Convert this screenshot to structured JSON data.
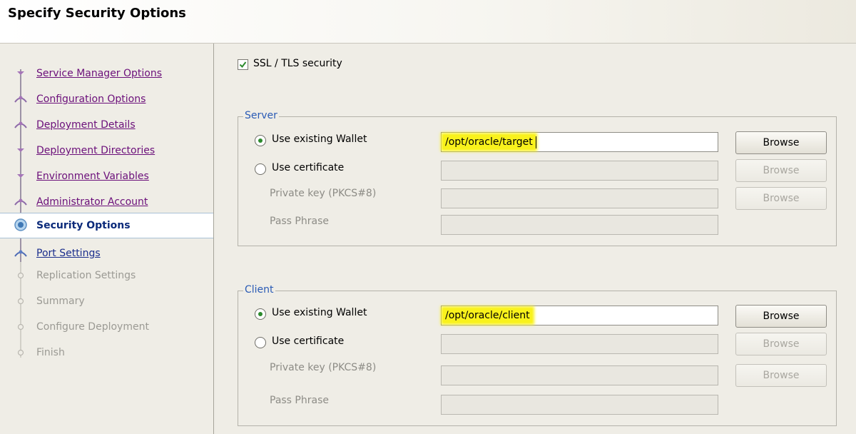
{
  "header": {
    "title": "Specify Security Options"
  },
  "steps": [
    {
      "label": "Service Manager Options",
      "state": "visited"
    },
    {
      "label": "Configuration Options",
      "state": "visited"
    },
    {
      "label": "Deployment Details",
      "state": "visited"
    },
    {
      "label": "Deployment Directories",
      "state": "visited"
    },
    {
      "label": "Environment Variables",
      "state": "visited"
    },
    {
      "label": "Administrator Account",
      "state": "visited"
    },
    {
      "label": "Security Options",
      "state": "current"
    },
    {
      "label": "Port Settings",
      "state": "next"
    },
    {
      "label": "Replication Settings",
      "state": "pending"
    },
    {
      "label": "Summary",
      "state": "pending"
    },
    {
      "label": "Configure Deployment",
      "state": "pending"
    },
    {
      "label": "Finish",
      "state": "pending"
    }
  ],
  "ssl": {
    "label": "SSL / TLS security",
    "checked": true
  },
  "server": {
    "legend": "Server",
    "wallet_label": "Use existing Wallet",
    "wallet_value": "/opt/oracle/target",
    "cert_label": "Use certificate",
    "private_key_label": "Private key (PKCS#8)",
    "pass_phrase_label": "Pass Phrase",
    "browse_label": "Browse",
    "selected": "wallet"
  },
  "client": {
    "legend": "Client",
    "wallet_label": "Use existing Wallet",
    "wallet_value": "/opt/oracle/client",
    "cert_label": "Use certificate",
    "private_key_label": "Private key (PKCS#8)",
    "pass_phrase_label": "Pass Phrase",
    "browse_label": "Browse",
    "selected": "wallet"
  },
  "colors": {
    "visited": "#6b0f7a",
    "next": "#1a2d8c",
    "highlight": "#f9f21c",
    "legend": "#2a5bb5"
  }
}
